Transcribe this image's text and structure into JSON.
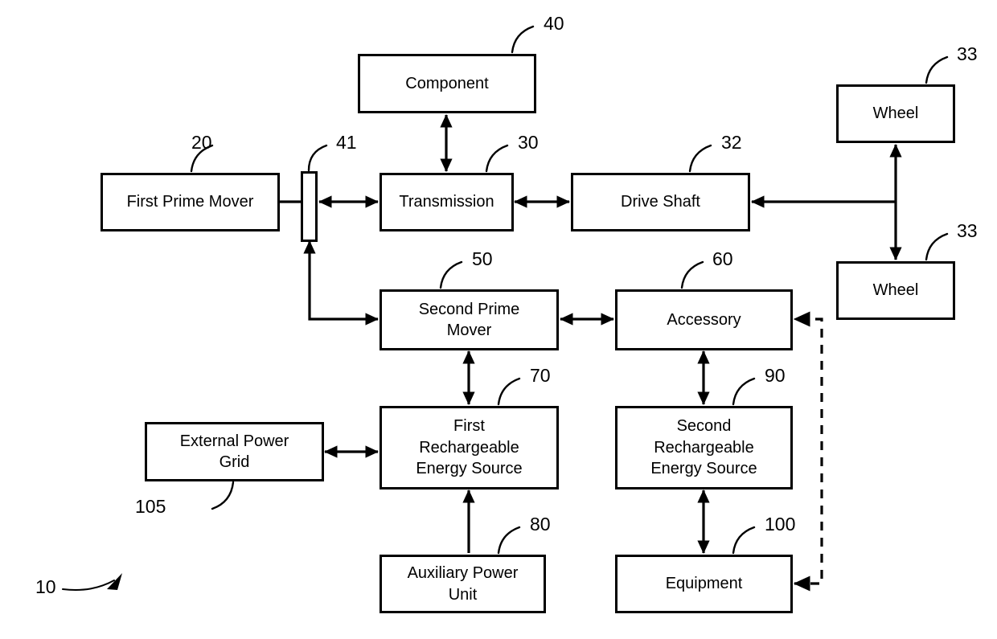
{
  "figure": {
    "title": "Hybrid powertrain block diagram",
    "figure_ref": "10",
    "line_color": "#000000",
    "background_color": "#ffffff"
  },
  "nodes": [
    {
      "id": "first_prime_mover",
      "label": "First Prime Mover",
      "ref": "20"
    },
    {
      "id": "coupling",
      "label": "",
      "ref": "41"
    },
    {
      "id": "component",
      "label": "Component",
      "ref": "40"
    },
    {
      "id": "transmission",
      "label": "Transmission",
      "ref": "30"
    },
    {
      "id": "drive_shaft",
      "label": "Drive Shaft",
      "ref": "32"
    },
    {
      "id": "wheel_top",
      "label": "Wheel",
      "ref": "33"
    },
    {
      "id": "wheel_bottom",
      "label": "Wheel",
      "ref": "33"
    },
    {
      "id": "second_prime_mover",
      "label": "Second Prime\nMover",
      "ref": "50"
    },
    {
      "id": "accessory",
      "label": "Accessory",
      "ref": "60"
    },
    {
      "id": "first_res",
      "label": "First\nRechargeable\nEnergy Source",
      "ref": "70"
    },
    {
      "id": "second_res",
      "label": "Second\nRechargeable\nEnergy Source",
      "ref": "90"
    },
    {
      "id": "external_power_grid",
      "label": "External Power\nGrid",
      "ref": "105"
    },
    {
      "id": "auxiliary_power_unit",
      "label": "Auxiliary Power\nUnit",
      "ref": "80"
    },
    {
      "id": "equipment",
      "label": "Equipment",
      "ref": "100"
    }
  ],
  "connections": [
    {
      "from": "first_prime_mover",
      "to": "coupling",
      "style": "solid",
      "arrows": "none"
    },
    {
      "from": "coupling",
      "to": "transmission",
      "style": "solid",
      "arrows": "both"
    },
    {
      "from": "transmission",
      "to": "component",
      "style": "solid",
      "arrows": "both"
    },
    {
      "from": "transmission",
      "to": "drive_shaft",
      "style": "solid",
      "arrows": "both"
    },
    {
      "from": "wheel_top",
      "to": "drive_shaft",
      "style": "solid",
      "arrows": "both"
    },
    {
      "from": "drive_shaft",
      "to": "wheel_bottom",
      "style": "solid",
      "arrows": "both"
    },
    {
      "from": "second_prime_mover",
      "to": "coupling",
      "style": "solid",
      "arrows": "both"
    },
    {
      "from": "second_prime_mover",
      "to": "accessory",
      "style": "solid",
      "arrows": "both"
    },
    {
      "from": "second_prime_mover",
      "to": "first_res",
      "style": "solid",
      "arrows": "both"
    },
    {
      "from": "accessory",
      "to": "second_res",
      "style": "solid",
      "arrows": "both"
    },
    {
      "from": "external_power_grid",
      "to": "first_res",
      "style": "solid",
      "arrows": "both"
    },
    {
      "from": "auxiliary_power_unit",
      "to": "first_res",
      "style": "solid",
      "arrows": "single"
    },
    {
      "from": "second_res",
      "to": "equipment",
      "style": "solid",
      "arrows": "both"
    },
    {
      "from": "equipment",
      "to": "accessory",
      "style": "dashed",
      "arrows": "both"
    }
  ],
  "labels": {
    "first_prime_mover": "First Prime Mover",
    "component": "Component",
    "transmission": "Transmission",
    "drive_shaft": "Drive Shaft",
    "wheel_top": "Wheel",
    "wheel_bottom": "Wheel",
    "second_prime_mover": "Second Prime\nMover",
    "accessory": "Accessory",
    "first_res": "First\nRechargeable\nEnergy Source",
    "second_res": "Second\nRechargeable\nEnergy Source",
    "external_power_grid": "External Power\nGrid",
    "auxiliary_power_unit": "Auxiliary Power\nUnit",
    "equipment": "Equipment"
  },
  "refnums": {
    "figure": "10",
    "first_prime_mover": "20",
    "transmission": "30",
    "drive_shaft": "32",
    "wheel_top": "33",
    "wheel_bottom": "33",
    "component": "40",
    "coupling": "41",
    "second_prime_mover": "50",
    "accessory": "60",
    "first_res": "70",
    "auxiliary_power_unit": "80",
    "second_res": "90",
    "equipment": "100",
    "external_power_grid": "105"
  }
}
